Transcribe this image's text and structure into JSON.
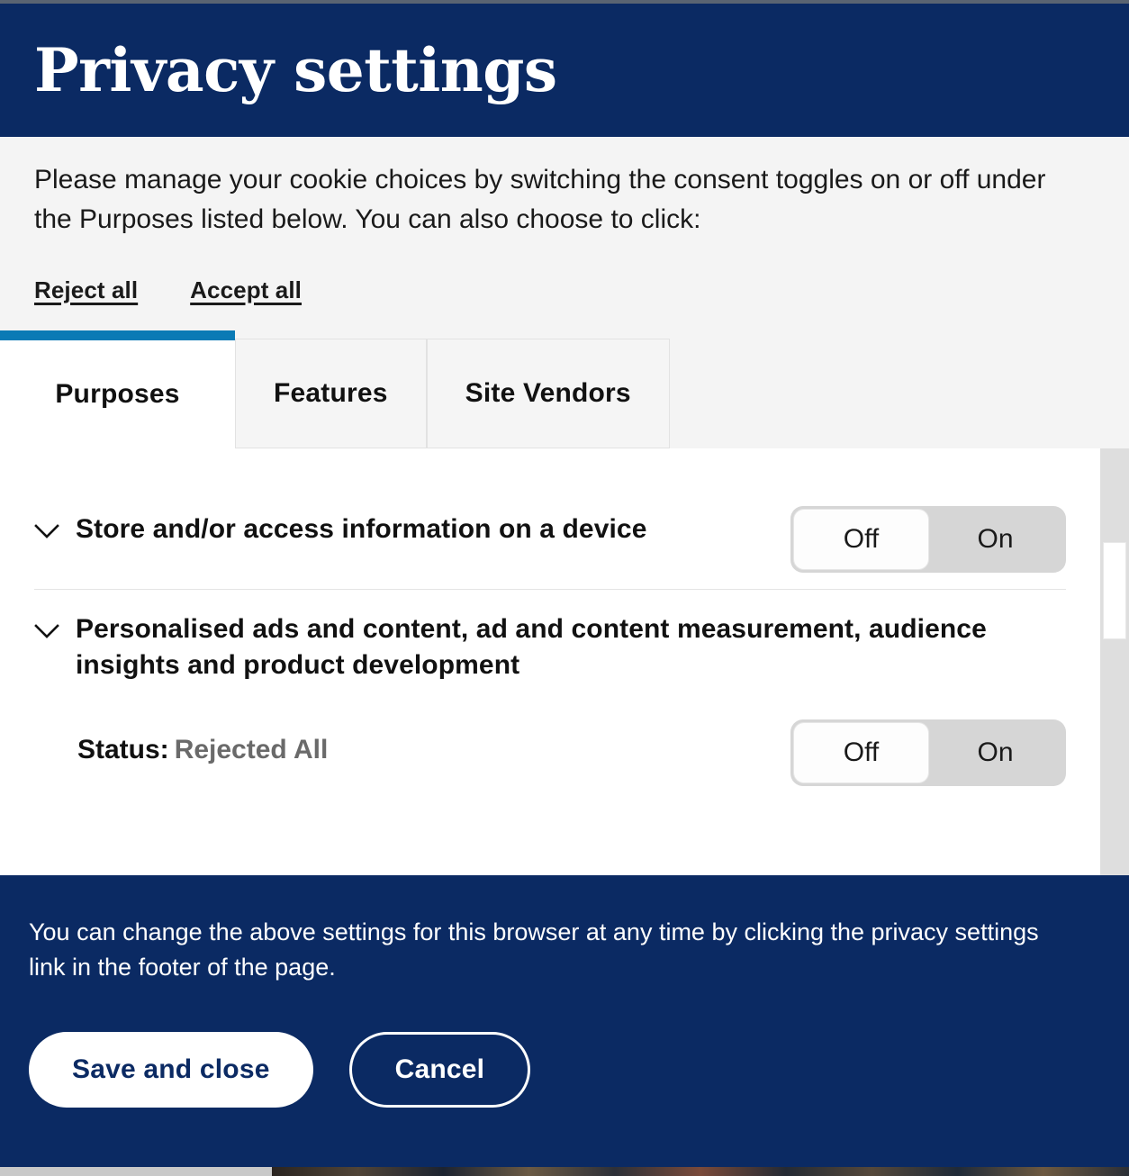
{
  "header": {
    "title": "Privacy settings"
  },
  "intro": {
    "text": "Please manage your cookie choices by switching the consent toggles on or off under the Purposes listed below. You can also choose to click:",
    "reject_all_label": "Reject all",
    "accept_all_label": "Accept all"
  },
  "tabs": [
    {
      "label": "Purposes",
      "active": true
    },
    {
      "label": "Features",
      "active": false
    },
    {
      "label": "Site Vendors",
      "active": false
    }
  ],
  "toggle": {
    "off_label": "Off",
    "on_label": "On"
  },
  "purposes": [
    {
      "label": "Store and/or access information on a device",
      "expand_icon": "chevron-down-icon",
      "selected": "Off"
    },
    {
      "label": "Personalised ads and content, ad and content measurement, audience insights and product development",
      "expand_icon": "chevron-down-icon",
      "selected": "Off",
      "status_key": "Status:",
      "status_value": "Rejected All"
    }
  ],
  "footer": {
    "note": "You can change the above settings for this browser at any time by clicking the privacy settings link in the footer of the page.",
    "save_label": "Save and close",
    "cancel_label": "Cancel"
  },
  "colors": {
    "brand_navy": "#0b2a63",
    "accent_blue": "#0a7ab5",
    "panel_bg": "#f4f4f4",
    "toggle_track": "#d6d6d6",
    "status_value": "#6a6a6a"
  }
}
